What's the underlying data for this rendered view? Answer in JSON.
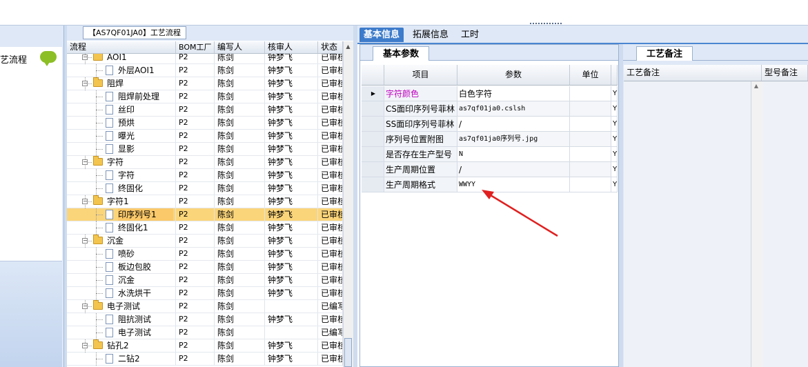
{
  "left_panel": {
    "title": "艺流程"
  },
  "tree": {
    "caption": "【AS7QF01JA0】工艺流程",
    "columns": [
      "流程",
      "BOM工厂",
      "编写人",
      "核审人",
      "状态"
    ],
    "rows": [
      {
        "name": "AOI1",
        "level": 0,
        "type": "folder",
        "bom": "P2",
        "writer": "陈剑",
        "reviewer": "钟梦飞",
        "status": "已审核"
      },
      {
        "name": "外层AOI1",
        "level": 1,
        "type": "doc",
        "bom": "P2",
        "writer": "陈剑",
        "reviewer": "钟梦飞",
        "status": "已审核"
      },
      {
        "name": "阻焊",
        "level": 0,
        "type": "folder",
        "bom": "P2",
        "writer": "陈剑",
        "reviewer": "钟梦飞",
        "status": "已审核"
      },
      {
        "name": "阻焊前处理",
        "level": 1,
        "type": "doc",
        "bom": "P2",
        "writer": "陈剑",
        "reviewer": "钟梦飞",
        "status": "已审核"
      },
      {
        "name": "丝印",
        "level": 1,
        "type": "doc",
        "bom": "P2",
        "writer": "陈剑",
        "reviewer": "钟梦飞",
        "status": "已审核"
      },
      {
        "name": "预烘",
        "level": 1,
        "type": "doc",
        "bom": "P2",
        "writer": "陈剑",
        "reviewer": "钟梦飞",
        "status": "已审核"
      },
      {
        "name": "曝光",
        "level": 1,
        "type": "doc",
        "bom": "P2",
        "writer": "陈剑",
        "reviewer": "钟梦飞",
        "status": "已审核"
      },
      {
        "name": "显影",
        "level": 1,
        "type": "doc",
        "bom": "P2",
        "writer": "陈剑",
        "reviewer": "钟梦飞",
        "status": "已审核"
      },
      {
        "name": "字符",
        "level": 0,
        "type": "folder",
        "bom": "P2",
        "writer": "陈剑",
        "reviewer": "钟梦飞",
        "status": "已审核"
      },
      {
        "name": "字符",
        "level": 1,
        "type": "doc",
        "bom": "P2",
        "writer": "陈剑",
        "reviewer": "钟梦飞",
        "status": "已审核"
      },
      {
        "name": "终固化",
        "level": 1,
        "type": "doc",
        "bom": "P2",
        "writer": "陈剑",
        "reviewer": "钟梦飞",
        "status": "已审核"
      },
      {
        "name": "字符1",
        "level": 0,
        "type": "folder",
        "bom": "P2",
        "writer": "陈剑",
        "reviewer": "钟梦飞",
        "status": "已审核"
      },
      {
        "name": "印序列号1",
        "level": 1,
        "type": "doc",
        "bom": "P2",
        "writer": "陈剑",
        "reviewer": "钟梦飞",
        "status": "已审核",
        "selected": true
      },
      {
        "name": "终固化1",
        "level": 1,
        "type": "doc",
        "bom": "P2",
        "writer": "陈剑",
        "reviewer": "钟梦飞",
        "status": "已审核"
      },
      {
        "name": "沉金",
        "level": 0,
        "type": "folder",
        "bom": "P2",
        "writer": "陈剑",
        "reviewer": "钟梦飞",
        "status": "已审核"
      },
      {
        "name": "喷砂",
        "level": 1,
        "type": "doc",
        "bom": "P2",
        "writer": "陈剑",
        "reviewer": "钟梦飞",
        "status": "已审核"
      },
      {
        "name": "板边包胶",
        "level": 1,
        "type": "doc",
        "bom": "P2",
        "writer": "陈剑",
        "reviewer": "钟梦飞",
        "status": "已审核"
      },
      {
        "name": "沉金",
        "level": 1,
        "type": "doc",
        "bom": "P2",
        "writer": "陈剑",
        "reviewer": "钟梦飞",
        "status": "已审核"
      },
      {
        "name": "水洗烘干",
        "level": 1,
        "type": "doc",
        "bom": "P2",
        "writer": "陈剑",
        "reviewer": "钟梦飞",
        "status": "已审核"
      },
      {
        "name": "电子测试",
        "level": 0,
        "type": "folder",
        "bom": "P2",
        "writer": "陈剑",
        "reviewer": "",
        "status": "已编写"
      },
      {
        "name": "阻抗测试",
        "level": 1,
        "type": "doc",
        "bom": "P2",
        "writer": "陈剑",
        "reviewer": "钟梦飞",
        "status": "已审核"
      },
      {
        "name": "电子测试",
        "level": 1,
        "type": "doc",
        "bom": "P2",
        "writer": "陈剑",
        "reviewer": "",
        "status": "已编写"
      },
      {
        "name": "钻孔2",
        "level": 0,
        "type": "folder",
        "bom": "P2",
        "writer": "陈剑",
        "reviewer": "钟梦飞",
        "status": "已审核"
      },
      {
        "name": "二钻2",
        "level": 1,
        "type": "doc",
        "bom": "P2",
        "writer": "陈剑",
        "reviewer": "钟梦飞",
        "status": "已审核"
      }
    ]
  },
  "right_tabs": [
    "基本信息",
    "拓展信息",
    "工时"
  ],
  "basic": {
    "subtab": "基本参数",
    "columns": [
      "项目",
      "参数",
      "单位"
    ],
    "rows": [
      {
        "item": "字符颜色",
        "value": "白色字符",
        "unit": "",
        "flag": "Y",
        "current": true
      },
      {
        "item": "CS面印序列号菲林",
        "value": "as7qf01ja0.cslsh",
        "unit": "",
        "flag": "Y"
      },
      {
        "item": "SS面印序列号菲林",
        "value": "/",
        "unit": "",
        "flag": "Y"
      },
      {
        "item": "序列号位置附图",
        "value": "as7qf01ja0序列号.jpg",
        "unit": "",
        "flag": "Y"
      },
      {
        "item": "是否存在生产型号",
        "value": "N",
        "unit": "",
        "flag": "Y"
      },
      {
        "item": "生产周期位置",
        "value": "/",
        "unit": "",
        "flag": "Y"
      },
      {
        "item": "生产周期格式",
        "value": "WWYY",
        "unit": "",
        "flag": "Y"
      }
    ]
  },
  "remark": {
    "subtab": "工艺备注",
    "columns": [
      "工艺备注",
      "型号备注"
    ]
  },
  "colors": {
    "accent": "#3d7bcb",
    "highlight_item": "#c000c0",
    "selection": "#fbd57a",
    "arrow": "#e02020"
  }
}
